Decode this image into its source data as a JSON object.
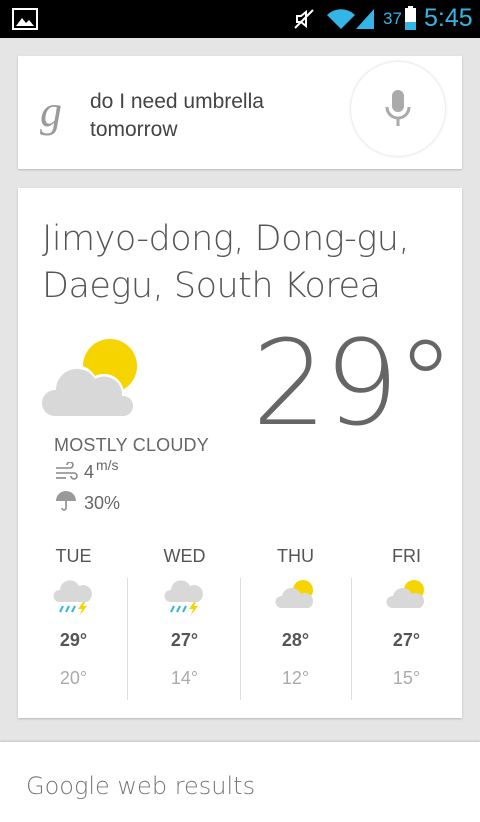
{
  "status_bar": {
    "battery_percent": "37",
    "time": "5:45",
    "accent_color": "#33b5e5"
  },
  "search": {
    "logo": "g",
    "query": "do I need umbrella tomorrow",
    "mic_icon": "mic-icon"
  },
  "weather": {
    "location": "Jimyo-dong, Dong-gu, Daegu, South Korea",
    "temperature": "29°",
    "condition": "MOSTLY CLOUDY",
    "wind_speed": "4",
    "wind_unit": "m/s",
    "precipitation": "30%",
    "forecast": [
      {
        "day": "TUE",
        "high": "29°",
        "low": "20°",
        "icon": "rain-thunder-icon"
      },
      {
        "day": "WED",
        "high": "27°",
        "low": "14°",
        "icon": "rain-thunder-icon"
      },
      {
        "day": "THU",
        "high": "28°",
        "low": "12°",
        "icon": "partly-cloudy-icon"
      },
      {
        "day": "FRI",
        "high": "27°",
        "low": "15°",
        "icon": "partly-cloudy-icon"
      }
    ]
  },
  "results": {
    "title": "Google web results"
  }
}
